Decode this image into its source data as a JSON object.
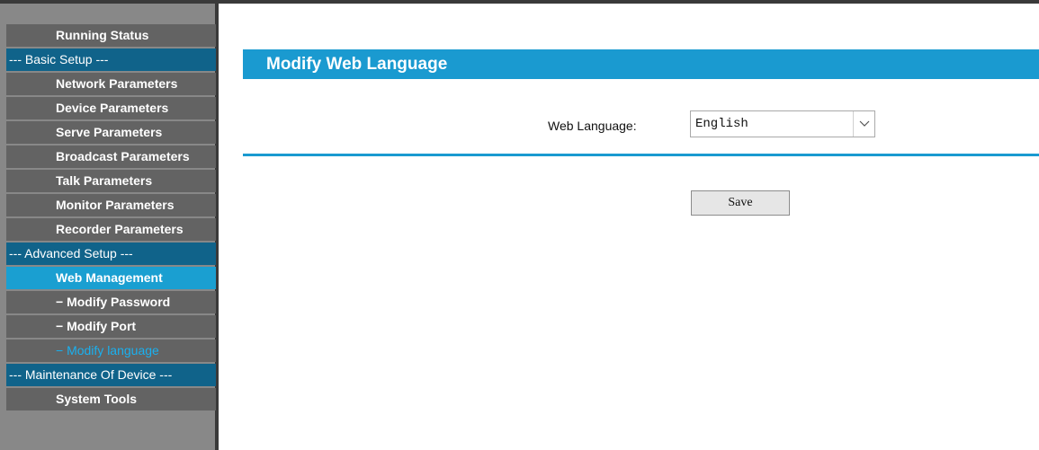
{
  "sidebar": {
    "items": [
      {
        "label": "Running Status"
      },
      {
        "label": "--- Basic Setup ---"
      },
      {
        "label": "Network Parameters"
      },
      {
        "label": "Device Parameters"
      },
      {
        "label": "Serve Parameters"
      },
      {
        "label": "Broadcast Parameters"
      },
      {
        "label": "Talk Parameters"
      },
      {
        "label": "Monitor Parameters"
      },
      {
        "label": "Recorder Parameters"
      },
      {
        "label": "--- Advanced Setup ---"
      },
      {
        "label": "Web Management"
      },
      {
        "label": "− Modify Password"
      },
      {
        "label": "− Modify Port"
      },
      {
        "label": "− Modify language"
      },
      {
        "label": "--- Maintenance Of Device ---"
      },
      {
        "label": "System Tools"
      }
    ]
  },
  "main": {
    "title": "Modify Web Language",
    "language_label": "Web Language:",
    "language_value": "English",
    "save_label": "Save"
  },
  "colors": {
    "accent": "#1a9ad0",
    "section": "#10638a",
    "selected": "#1a9fd1",
    "sidebar_item": "#636363",
    "sidebar_bg": "#888888"
  }
}
